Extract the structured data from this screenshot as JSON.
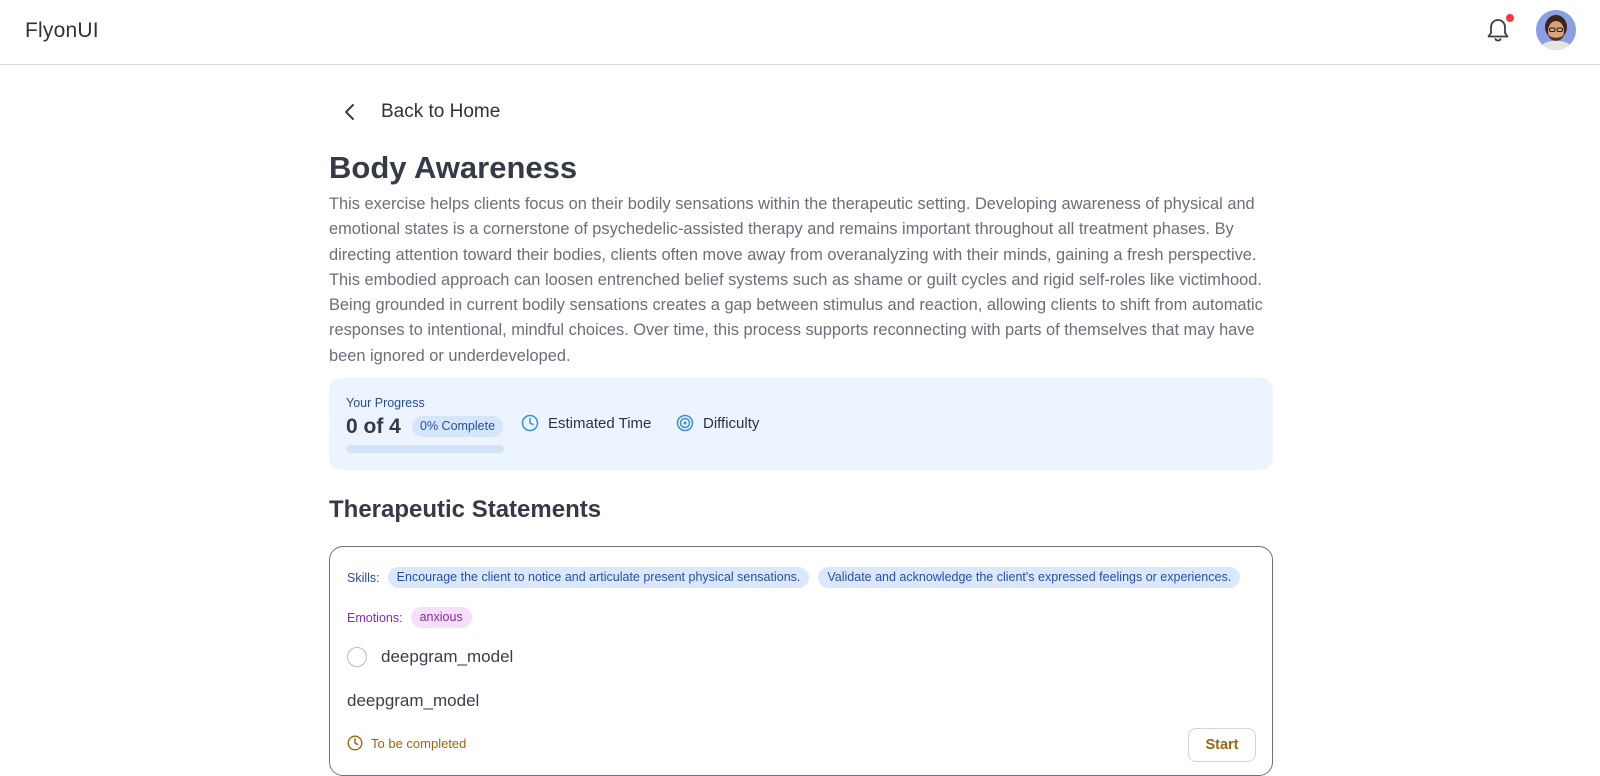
{
  "header": {
    "brand": "FlyonUI",
    "notification_icon": "bell-icon",
    "has_unread_notifications": true,
    "avatar": "user-avatar"
  },
  "nav": {
    "back_label": "Back to Home",
    "back_icon": "chevron-left-icon"
  },
  "exercise": {
    "title": "Body Awareness",
    "description": "This exercise helps clients focus on their bodily sensations within the therapeutic setting. Developing awareness of physical and emotional states is a cornerstone of psychedelic-assisted therapy and remains important throughout all treatment phases. By directing attention toward their bodies, clients often move away from overanalyzing with their minds, gaining a fresh perspective. This embodied approach can loosen entrenched belief systems such as shame or guilt cycles and rigid self-roles like victimhood. Being grounded in current bodily sensations creates a gap between stimulus and reaction, allowing clients to shift from automatic responses to intentional, mindful choices. Over time, this process supports reconnecting with parts of themselves that may have been ignored or underdeveloped."
  },
  "progress": {
    "label": "Your Progress",
    "count_text": "0 of 4",
    "badge": "0% Complete",
    "fraction": 0,
    "estimated_time_label": "Estimated Time",
    "estimated_time_icon": "clock-icon",
    "difficulty_label": "Difficulty",
    "difficulty_icon": "target-icon"
  },
  "statements": {
    "section_title": "Therapeutic Statements",
    "items": [
      {
        "skills_label": "Skills:",
        "skills": [
          "Encourage the client to notice and articulate present physical sensations.",
          "Validate and acknowledge the client's expressed feelings or experiences."
        ],
        "emotions_label": "Emotions:",
        "emotions": [
          "anxious"
        ],
        "option_label": "deepgram_model",
        "text": "deepgram_model",
        "status": "To be completed",
        "status_icon": "clock-icon",
        "action_label": "Start"
      }
    ]
  },
  "colors": {
    "accent_blue": "#2650a8",
    "progress_card_bg": "#ecf4ff",
    "emotion_purple": "#8a2ba8",
    "status_amber": "#a0640d",
    "notification_dot": "#ef3b3b"
  }
}
